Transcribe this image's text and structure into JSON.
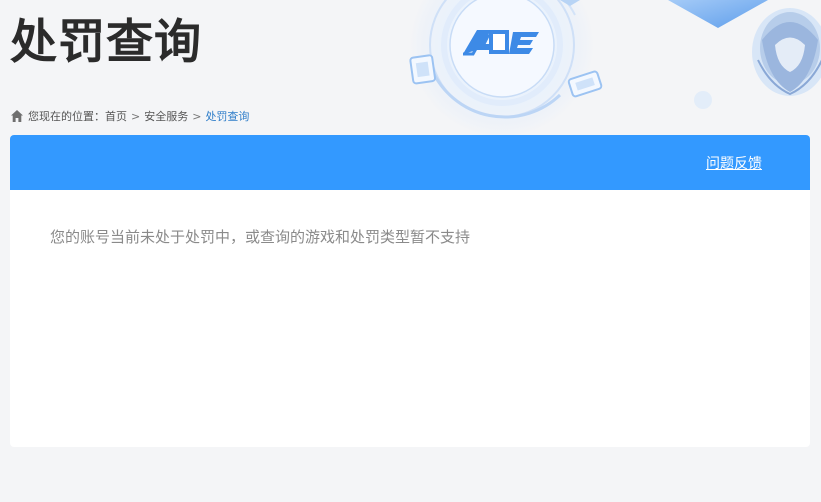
{
  "page": {
    "title": "处罚查询",
    "logo_text": "ACE"
  },
  "breadcrumb": {
    "prefix": "您现在的位置：",
    "items": [
      "首页",
      "安全服务",
      "处罚查询"
    ],
    "separator": ">"
  },
  "panel": {
    "feedback_link": "问题反馈",
    "message": "您的账号当前未处于处罚中，或查询的游戏和处罚类型暂不支持"
  },
  "colors": {
    "header_bar": "#3399ff",
    "breadcrumb_current": "#2e7dc9",
    "page_background": "#f4f5f7"
  },
  "icons": {
    "breadcrumb_home": "home-icon",
    "hero_logo": "ace-logo"
  }
}
